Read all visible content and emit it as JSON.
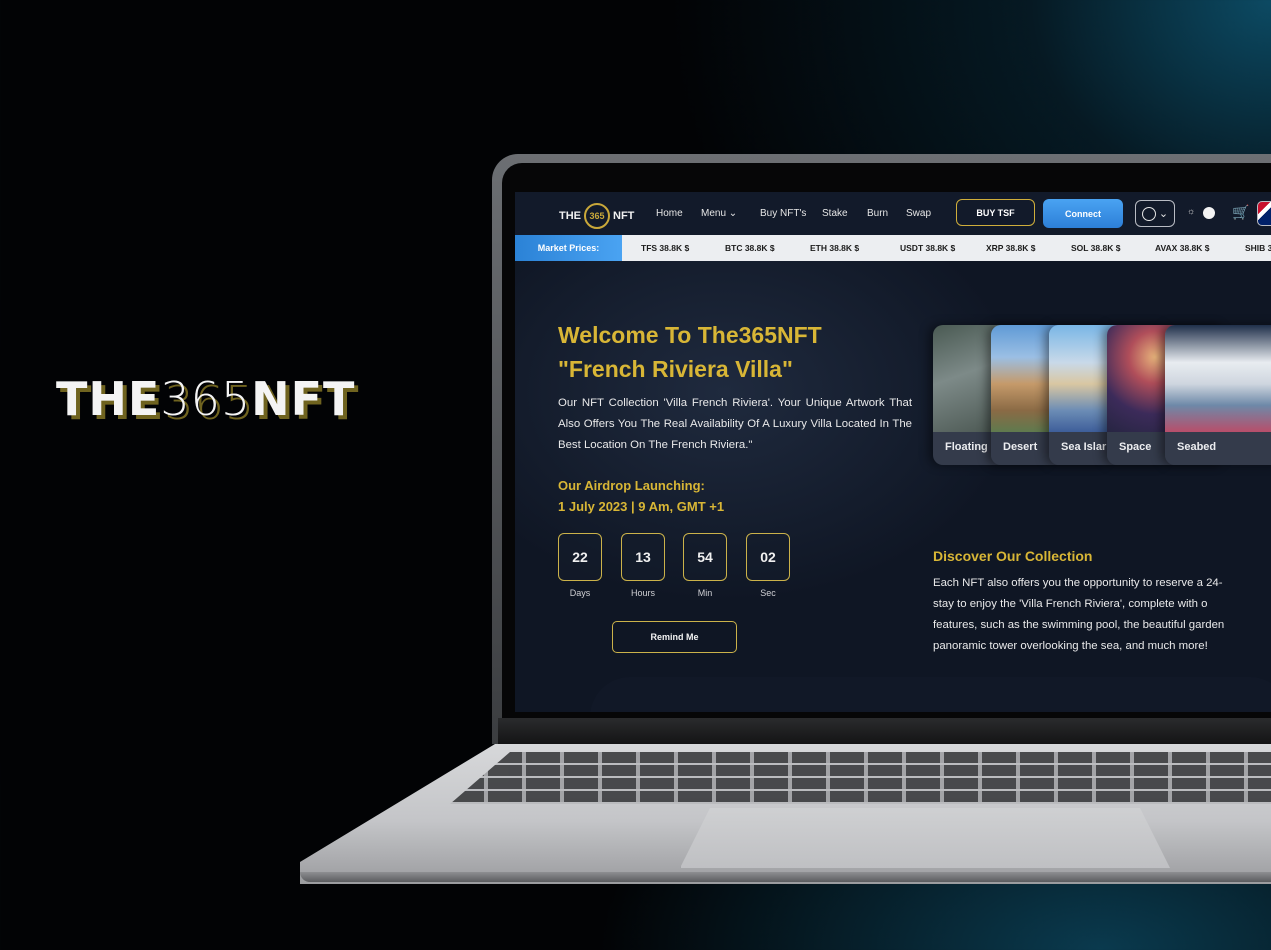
{
  "brand": {
    "name_bold_left": "THE",
    "name_thin": "365",
    "name_bold_right": "NFT"
  },
  "nav": {
    "logo_left": "THE",
    "logo_emblem": "365",
    "logo_right": "NFT",
    "links": [
      "Home",
      "Menu",
      "Buy NFT's",
      "Stake",
      "Burn",
      "Swap"
    ],
    "menu_chevron": "⌄",
    "buy_label": "BUY TSF",
    "connect_label": "Connect",
    "user_icon": "user-circle-icon",
    "theme_icon": "sun-icon",
    "cart_icon": "cart-icon"
  },
  "ticker": {
    "label": "Market Prices:",
    "items": [
      "TFS 38.8K $",
      "BTC 38.8K $",
      "ETH 38.8K $",
      "USDT 38.8K $",
      "XRP 38.8K $",
      "SOL 38.8K $",
      "AVAX 38.8K $",
      "SHIB 3"
    ]
  },
  "hero": {
    "title_line1": "Welcome To The365NFT",
    "title_line2": "\"French Riviera Villa\"",
    "description": "Our NFT Collection 'Villa French Riviera'. Your Unique Artwork That Also Offers You The Real Availability Of A Luxury Villa Located In The Best Location On The French Riviera.\"",
    "airdrop_line1": "Our Airdrop Launching:",
    "airdrop_line2": "1 July 2023 | 9 Am, GMT +1",
    "countdown": [
      {
        "value": "22",
        "label": "Days"
      },
      {
        "value": "13",
        "label": "Hours"
      },
      {
        "value": "54",
        "label": "Min"
      },
      {
        "value": "02",
        "label": "Sec"
      }
    ],
    "remind_label": "Remind Me"
  },
  "cards": [
    "Floating",
    "Desert",
    "Sea Islar",
    "Space",
    "Seabed"
  ],
  "collection": {
    "title": "Discover Our Collection",
    "lines": [
      "Each NFT also offers you the opportunity to reserve a 24-",
      "stay to enjoy the 'Villa French Riviera', complete with o",
      "features, such as the swimming pool, the beautiful garden",
      "panoramic tower overlooking the sea, and much more!"
    ]
  }
}
